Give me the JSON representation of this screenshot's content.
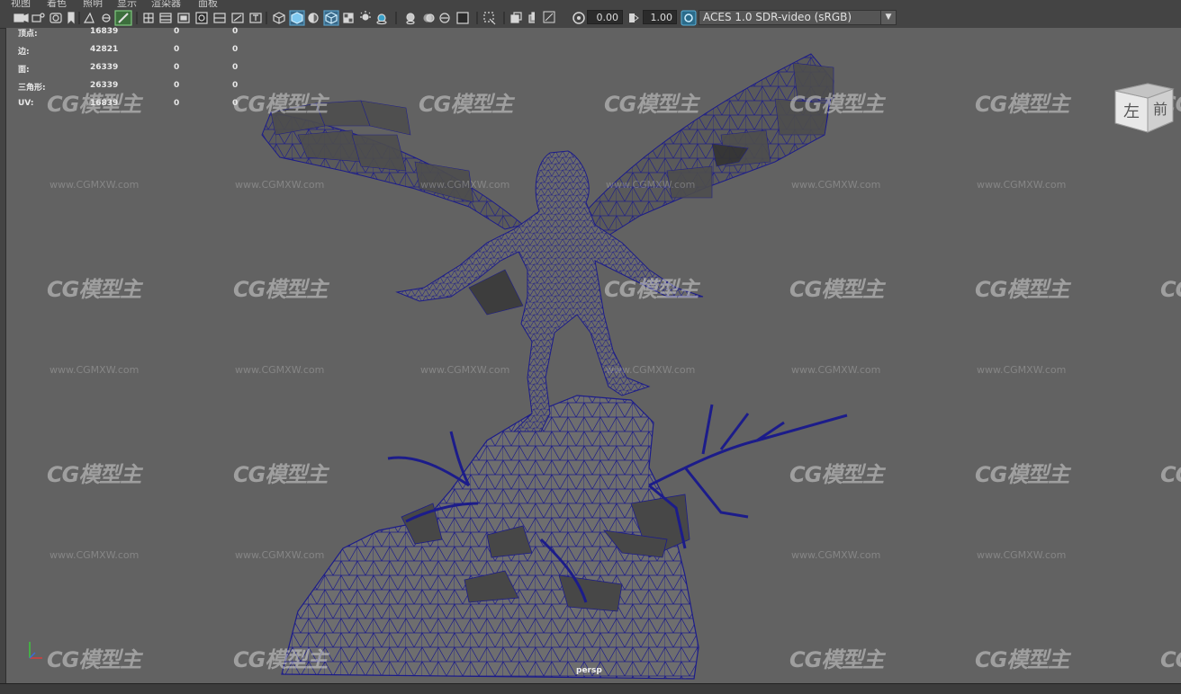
{
  "menu": {
    "items": [
      "视图",
      "着色",
      "照明",
      "显示",
      "渲染器",
      "面板"
    ]
  },
  "toolbar": {
    "camera_near_value": "0.00",
    "exposure_value": "1.00",
    "color_space": "ACES 1.0 SDR-video (sRGB)",
    "icons": [
      "camera-icon",
      "camera-attributes-icon",
      "bookmark-icon",
      "image-plane-icon",
      "grid-icon",
      "film-gate-icon",
      "resolution-gate-icon",
      "gate-mask-icon",
      "field-chart-icon",
      "safe-action-icon",
      "safe-title-icon",
      "wireframe-icon",
      "smooth-shade-icon",
      "default-material-icon",
      "shaded-wireframe-icon",
      "textured-icon",
      "lights-icon",
      "shadows-icon",
      "screen-space-ao-icon",
      "motion-blur-icon",
      "multisample-aa-icon",
      "depth-of-field-icon",
      "xray-icon",
      "xray-active-icon",
      "xray-joints-icon",
      "isolate-select-icon",
      "exposure-icon",
      "gamma-icon",
      "color-management-icon"
    ]
  },
  "hud": {
    "rows": [
      {
        "label": "顶点:",
        "v1": "16839",
        "v2": "0",
        "v3": "0"
      },
      {
        "label": "边:",
        "v1": "42821",
        "v2": "0",
        "v3": "0"
      },
      {
        "label": "面:",
        "v1": "26339",
        "v2": "0",
        "v3": "0"
      },
      {
        "label": "三角形:",
        "v1": "26339",
        "v2": "0",
        "v3": "0"
      },
      {
        "label": "UV:",
        "v1": "16839",
        "v2": "0",
        "v3": "0"
      }
    ]
  },
  "viewport": {
    "camera_name": "persp",
    "viewcube_left": "左",
    "viewcube_front": "前",
    "watermark_logo": "CG模型主",
    "watermark_url": "www.CGMXW.com",
    "wire_color": "#1c1c8a",
    "background_color": "#626262"
  }
}
